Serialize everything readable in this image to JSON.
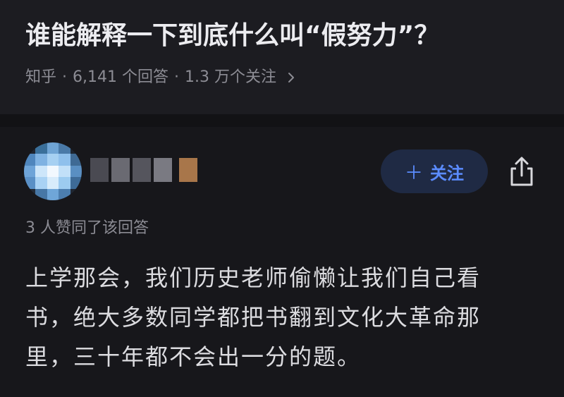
{
  "question": {
    "title": "谁能解释一下到底什么叫“假努力”？",
    "source": "知乎",
    "answer_count": "6,141 个回答",
    "follower_count": "1.3 万个关注"
  },
  "answer": {
    "follow_label": "关注",
    "follow_icon": "plus-icon",
    "share_icon": "share-icon",
    "upvote_summary": "3 人赞同了该回答",
    "body_lines": [
      "上学那会，我们历史老师偷懒让我们自己看",
      "书，绝大多数同学都把书翻到文化大革命那",
      "里，三十年都不会出一分的题。"
    ]
  },
  "colors": {
    "background": "#17171b",
    "header_background": "#1c1c21",
    "title_text": "#ececf0",
    "meta_text": "#8c8c94",
    "accent": "#5b8cff",
    "follow_button_bg": "#1f2a44"
  }
}
